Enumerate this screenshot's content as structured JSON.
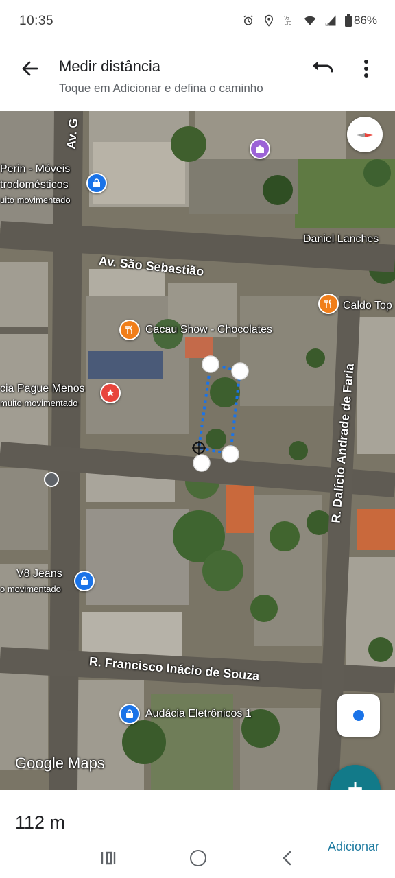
{
  "status_bar": {
    "time": "10:35",
    "battery": "86%",
    "icons": [
      "alarm-icon",
      "location-icon",
      "volte-icon",
      "wifi-icon",
      "signal-5g-icon",
      "battery-icon"
    ]
  },
  "header": {
    "title": "Medir distância",
    "subtitle": "Toque em Adicionar e defina o caminho",
    "icons": [
      "back-arrow-icon",
      "undo-icon",
      "more-vert-icon"
    ]
  },
  "map": {
    "places": [
      {
        "name": "Perin - Móveis",
        "line2": "trodomésticos",
        "note": "uito movimentado",
        "type": "shopping"
      },
      {
        "name": "Daniel Lanches",
        "type": "label"
      },
      {
        "name": "Caldo Top",
        "type": "restaurant"
      },
      {
        "name": "Cacau Show - Chocolates",
        "type": "restaurant"
      },
      {
        "name": "cia Pague Menos",
        "note": "muito movimentado",
        "type": "pharmacy"
      },
      {
        "name": "V8 Jeans",
        "note": "o movimentado",
        "type": "shopping"
      },
      {
        "name": "Audácia Eletrônicos 1",
        "type": "shopping"
      }
    ],
    "roads": {
      "av_top": "Av. G",
      "sao_sebastiao": "Av. São Sebastião",
      "dalicio": "R. Dalício Andrade de Faria",
      "francisco": "R. Francisco Inácio de Souza"
    },
    "logo": "Google Maps",
    "colors": {
      "path": "#1a73e8",
      "fab": "#127a89",
      "restaurant": "#f07e1a",
      "shopping": "#1a73e8",
      "pharmacy": "#e8453c",
      "landmark": "#9c63d6"
    }
  },
  "bottom": {
    "distance": "112 m",
    "add_label": "Adicionar",
    "fab_symbol": "+"
  }
}
